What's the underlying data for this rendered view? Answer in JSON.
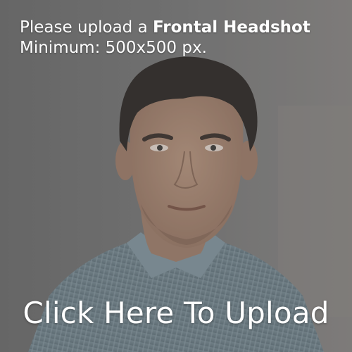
{
  "prompt": {
    "line1_prefix": "Please upload a ",
    "line1_emphasis": "Frontal Headshot",
    "line2": "Minimum: 500x500 px."
  },
  "upload_button": {
    "label": "Click Here To Upload"
  },
  "example_photo": {
    "subject": "frontal headshot of a man in a striped shirt",
    "colors": {
      "background": "#7c7c7c",
      "hair": "#2c2724",
      "skin": "#b08c77",
      "shirt": "#6d808a"
    }
  }
}
